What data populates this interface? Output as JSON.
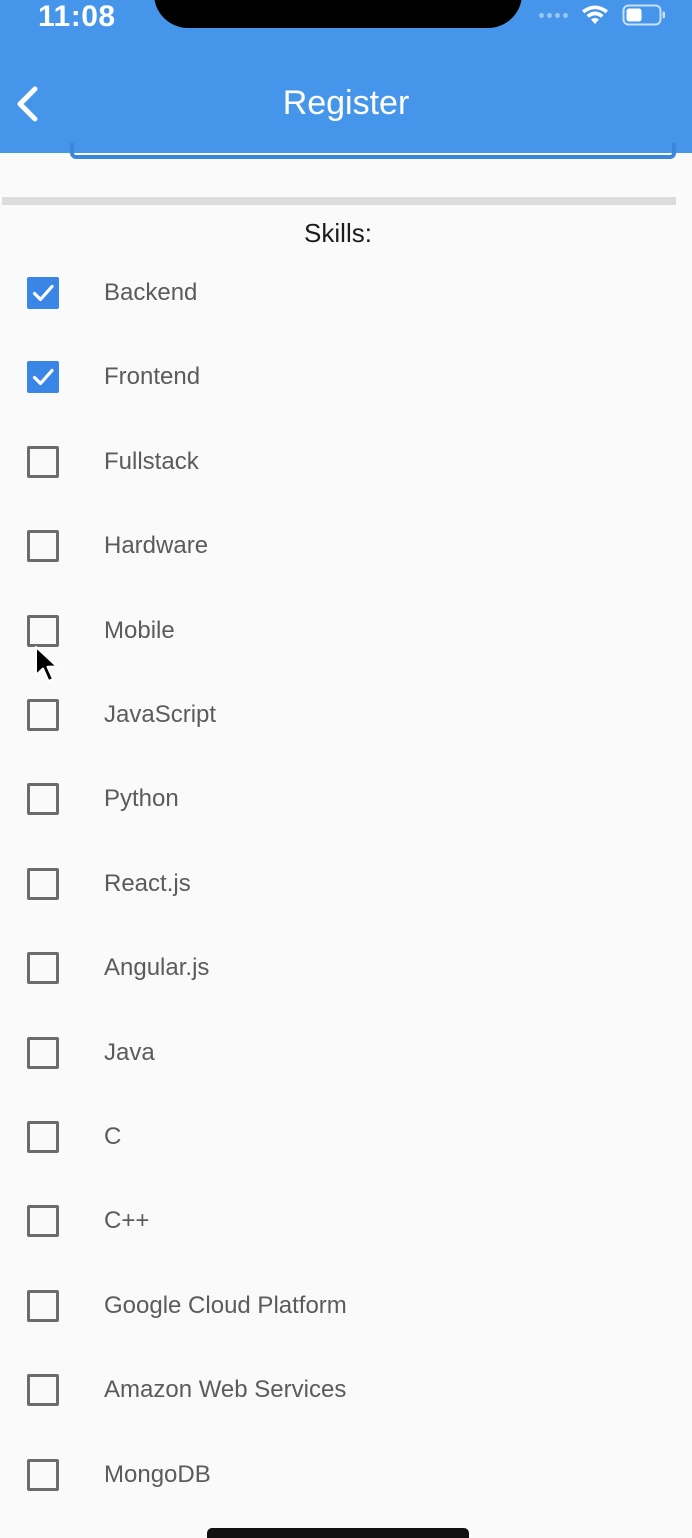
{
  "status_bar": {
    "time": "11:08"
  },
  "header": {
    "title": "Register"
  },
  "skills": {
    "heading": "Skills:",
    "items": [
      {
        "label": "Backend",
        "checked": true
      },
      {
        "label": "Frontend",
        "checked": true
      },
      {
        "label": "Fullstack",
        "checked": false
      },
      {
        "label": "Hardware",
        "checked": false
      },
      {
        "label": "Mobile",
        "checked": false
      },
      {
        "label": "JavaScript",
        "checked": false
      },
      {
        "label": "Python",
        "checked": false
      },
      {
        "label": "React.js",
        "checked": false
      },
      {
        "label": "Angular.js",
        "checked": false
      },
      {
        "label": "Java",
        "checked": false
      },
      {
        "label": "C",
        "checked": false
      },
      {
        "label": "C++",
        "checked": false
      },
      {
        "label": "Google Cloud Platform",
        "checked": false
      },
      {
        "label": "Amazon Web Services",
        "checked": false
      },
      {
        "label": "MongoDB",
        "checked": false
      }
    ]
  },
  "colors": {
    "app_bar": "#4596ea",
    "checkbox_active": "#3a86e6",
    "background": "#fafafa"
  }
}
